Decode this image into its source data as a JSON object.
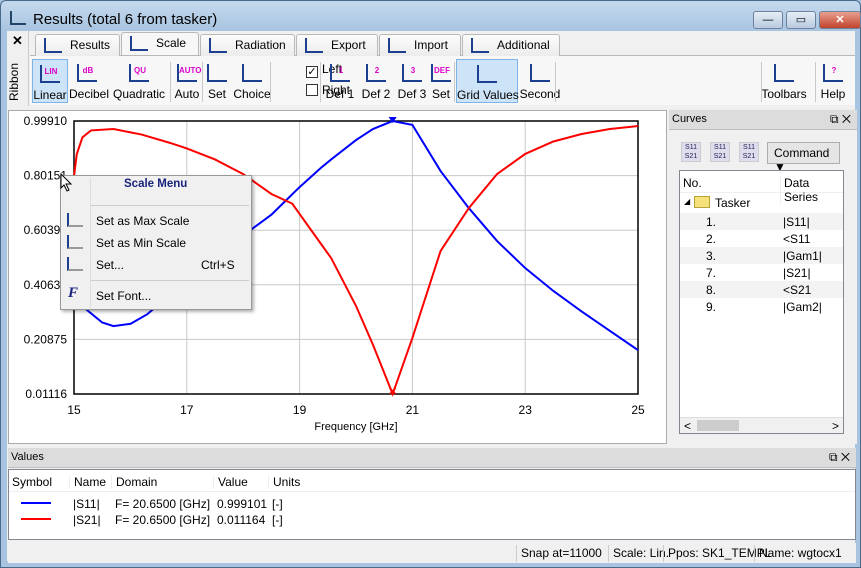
{
  "window": {
    "title": "Results (total 6 from tasker)",
    "minimize": "—",
    "maximize": "▭",
    "close": "✕"
  },
  "ribbon_strip": {
    "close": "✕",
    "label": "Ribbon"
  },
  "tabs": [
    {
      "label": "Results"
    },
    {
      "label": "Scale",
      "active": true
    },
    {
      "label": "Radiation"
    },
    {
      "label": "Export"
    },
    {
      "label": "Import"
    },
    {
      "label": "Additional"
    }
  ],
  "ribbon": {
    "buttons": [
      {
        "label": "Linear",
        "icon": "LIN",
        "active": true
      },
      {
        "label": "Decibel",
        "icon": "dB"
      },
      {
        "label": "Quadratic",
        "icon": "QU"
      },
      {
        "label": "Auto",
        "icon": "AUTO"
      },
      {
        "label": "Set",
        "icon": ""
      },
      {
        "label": "Choice",
        "icon": ""
      },
      {
        "label": "Def 1",
        "icon": "1"
      },
      {
        "label": "Def 2",
        "icon": "2"
      },
      {
        "label": "Def 3",
        "icon": "3"
      },
      {
        "label": "Set",
        "icon": "DEF"
      },
      {
        "label": "Grid Values",
        "icon": "",
        "active": true
      },
      {
        "label": "Second",
        "icon": ""
      },
      {
        "label": "Toolbars",
        "icon": ""
      },
      {
        "label": "Help",
        "icon": "?"
      }
    ],
    "left": {
      "label": "Left",
      "checked": true,
      "mark": "✓"
    },
    "right": {
      "label": "Right",
      "checked": false
    }
  },
  "chart_data": {
    "type": "line",
    "xlabel": "Frequency [GHz]",
    "ylabel": "",
    "xlim": [
      15,
      25
    ],
    "ylim": [
      0.01116,
      0.9991
    ],
    "xticks": [
      "15",
      "17",
      "19",
      "21",
      "23",
      "25"
    ],
    "yticks": [
      "0.99910",
      "0.80151",
      "0.60392",
      "0.40633",
      "0.20875",
      "0.01116"
    ],
    "grid": true,
    "series": [
      {
        "name": "|S11|",
        "color": "#0000ff",
        "x": [
          15,
          15.2,
          15.5,
          15.7,
          16,
          16.3,
          16.7,
          17,
          17.5,
          18,
          18.1,
          18.5,
          18.7,
          19,
          19.38,
          19.56,
          20,
          20.3,
          20.65,
          21,
          21.5,
          22,
          22.5,
          23,
          23.5,
          24,
          24.5,
          25
        ],
        "y": [
          0.42,
          0.32,
          0.27,
          0.257,
          0.265,
          0.3,
          0.37,
          0.43,
          0.52,
          0.58,
          0.6,
          0.66,
          0.7,
          0.76,
          0.83,
          0.86,
          0.93,
          0.97,
          0.999,
          0.985,
          0.818,
          0.684,
          0.565,
          0.467,
          0.384,
          0.31,
          0.24,
          0.17
        ]
      },
      {
        "name": "|S21|",
        "color": "#ff0000",
        "x": [
          15,
          15.05,
          15.15,
          15.3,
          15.7,
          16.2,
          16.7,
          17,
          17.5,
          18,
          18.5,
          18.87,
          19.38,
          19.56,
          20,
          20.3,
          20.65,
          21,
          21.5,
          22,
          22.5,
          23,
          23.5,
          24,
          24.5,
          25
        ],
        "y": [
          0.8,
          0.88,
          0.94,
          0.965,
          0.97,
          0.95,
          0.92,
          0.9,
          0.86,
          0.807,
          0.735,
          0.7,
          0.554,
          0.503,
          0.33,
          0.19,
          0.011,
          0.214,
          0.529,
          0.684,
          0.807,
          0.88,
          0.925,
          0.952,
          0.97,
          0.981
        ]
      }
    ]
  },
  "context_menu": {
    "title": "Scale Menu",
    "items": [
      {
        "label": "Set as Max Scale",
        "shortcut": ""
      },
      {
        "label": "Set as Min Scale",
        "shortcut": ""
      },
      {
        "label": "Set...",
        "shortcut": "Ctrl+S"
      },
      {
        "label": "Set Font...",
        "shortcut": ""
      }
    ]
  },
  "curves": {
    "title": "Curves",
    "command": "Command ▼",
    "buttons": [
      "S11 S21",
      "S11 S21",
      "S11 S21"
    ],
    "columns": [
      "No.",
      "Data Series"
    ],
    "group": "Tasker",
    "rows": [
      {
        "no": "1.",
        "series": "|S11|"
      },
      {
        "no": "2.",
        "series": "<S11"
      },
      {
        "no": "3.",
        "series": "|Gam1|"
      },
      {
        "no": "7.",
        "series": "|S21|"
      },
      {
        "no": "8.",
        "series": "<S21"
      },
      {
        "no": "9.",
        "series": "|Gam2|"
      }
    ]
  },
  "values": {
    "title": "Values",
    "columns": [
      "Symbol",
      "Name",
      "Domain",
      "Value",
      "Units"
    ],
    "rows": [
      {
        "name": "|S11|",
        "domain": "F= 20.6500 [GHz]",
        "value": "0.999101",
        "units": "[-]",
        "color": "#0000ff"
      },
      {
        "name": "|S21|",
        "domain": "F= 20.6500 [GHz]",
        "value": "0.011164",
        "units": "[-]",
        "color": "#ff0000"
      }
    ]
  },
  "status": {
    "snap": "Snap at=11000",
    "scale": "Scale: Lin.",
    "ppos": "Ppos: SK1_TEMPL",
    "name": "Name: wgtocx1"
  }
}
